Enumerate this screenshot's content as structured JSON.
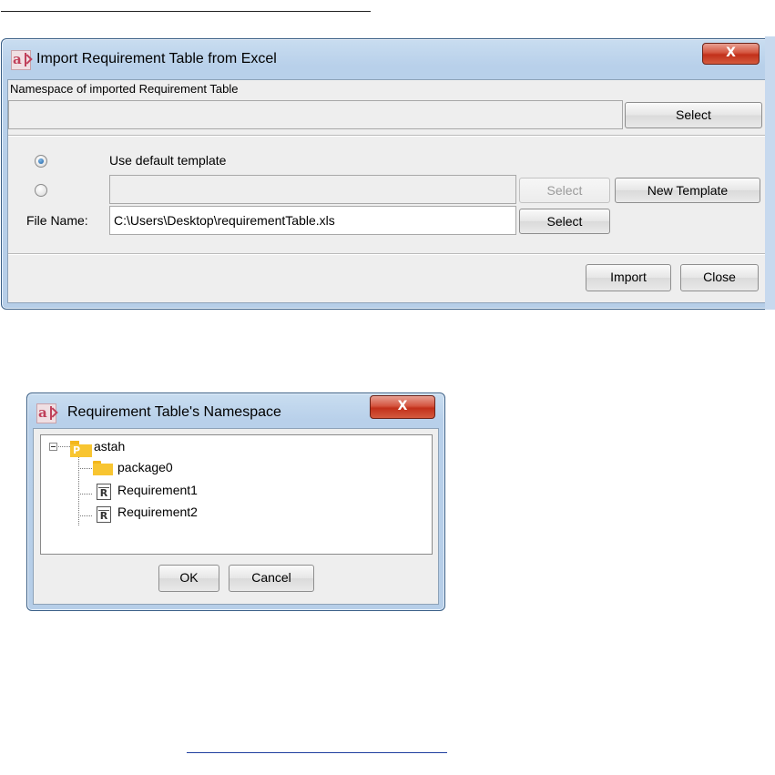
{
  "import_dialog": {
    "title": "Import Requirement Table from Excel",
    "namespace_label": "Namespace of imported Requirement Table",
    "namespace_value": "",
    "namespace_select": "Select",
    "use_default_label": "Use default template",
    "template_path": "",
    "template_select": "Select",
    "new_template": "New Template",
    "file_name_label": "File Name:",
    "file_name_value": "C:\\Users\\Desktop\\requirementTable.xls",
    "file_select": "Select",
    "import_button": "Import",
    "close_button": "Close",
    "default_template_selected": true
  },
  "namespace_dialog": {
    "title": "Requirement Table's Namespace",
    "tree": {
      "root": "astah",
      "children": [
        {
          "label": "package0",
          "kind": "package"
        },
        {
          "label": "Requirement1",
          "kind": "requirement"
        },
        {
          "label": "Requirement2",
          "kind": "requirement"
        }
      ]
    },
    "ok_button": "OK",
    "cancel_button": "Cancel"
  },
  "close_glyph": "X",
  "requirement_glyph": "R",
  "package_glyph": "P",
  "colors": {
    "title_bar": "#b8d0ea",
    "close_red": "#c2301a",
    "folder_yellow": "#f8c531",
    "radio_selected": "#1c5fa2",
    "link_underline": "#1f3f9f"
  }
}
